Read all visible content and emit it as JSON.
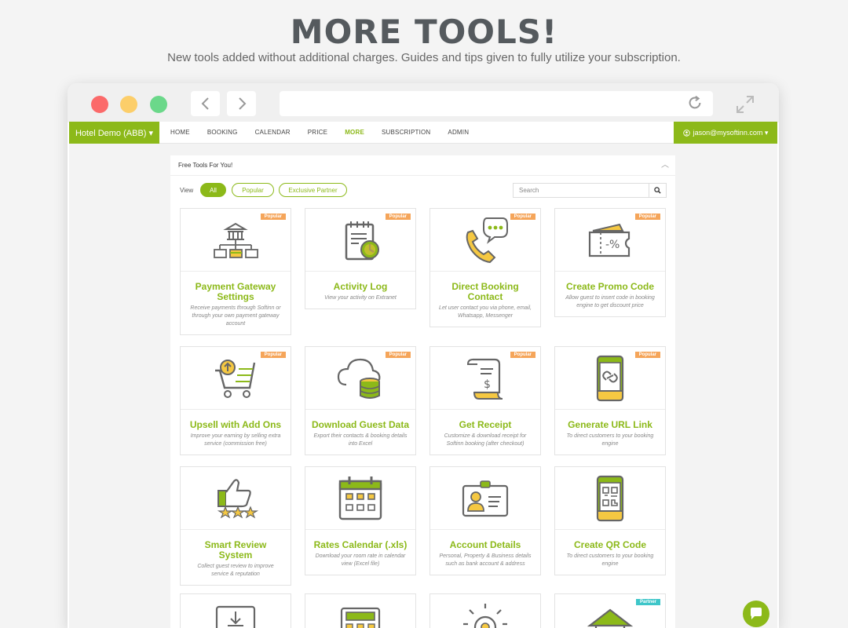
{
  "hero": {
    "title": "MORE TOOLS!",
    "subtitle": "New tools added without additional charges. Guides and tips given to fully utilize your subscription."
  },
  "browser": {
    "back_icon": "chevron-left-icon",
    "forward_icon": "chevron-right-icon",
    "reload_icon": "reload-icon",
    "expand_icon": "expand-icon"
  },
  "nav": {
    "hotel": "Hotel Demo (ABB) ▾",
    "items": [
      "HOME",
      "BOOKING",
      "CALENDAR",
      "PRICE",
      "MORE",
      "SUBSCRIPTION",
      "ADMIN"
    ],
    "active": "MORE",
    "user": "jason@mysoftinn.com ▾"
  },
  "panel": {
    "title": "Free Tools For You!",
    "view_label": "View",
    "filters": [
      "All",
      "Popular",
      "Exclusive Partner"
    ],
    "active_filter": "All",
    "search_placeholder": "Search"
  },
  "tools": [
    {
      "title": "Payment Gateway Settings",
      "desc": "Receive payments through Softinn or through your own payment gateway account",
      "badge": "Popular",
      "icon": "bank-transfer-icon"
    },
    {
      "title": "Activity Log",
      "desc": "View your activity on Extranet",
      "badge": "Popular",
      "icon": "activity-log-icon"
    },
    {
      "title": "Direct Booking Contact",
      "desc": "Let user contact you via phone, email, Whatsapp, Messenger",
      "badge": "Popular",
      "icon": "phone-chat-icon"
    },
    {
      "title": "Create Promo Code",
      "desc": "Allow guest to insert code in booking engine to get discount price",
      "badge": "Popular",
      "icon": "promo-ticket-icon"
    },
    {
      "title": "Upsell with Add Ons",
      "desc": "Improve your earning by selling extra service (commission free)",
      "badge": "Popular",
      "icon": "cart-upsell-icon"
    },
    {
      "title": "Download Guest Data",
      "desc": "Export their contacts & booking details into Excel",
      "badge": "Popular",
      "icon": "cloud-database-icon"
    },
    {
      "title": "Get Receipt",
      "desc": "Customize & download receipt for Softinn booking (after checkout)",
      "badge": "Popular",
      "icon": "receipt-icon"
    },
    {
      "title": "Generate URL Link",
      "desc": "To direct customers to your booking engine",
      "badge": "Popular",
      "icon": "mobile-link-icon"
    },
    {
      "title": "Smart Review System",
      "desc": "Collect guest review to improve service & reputation",
      "badge": "",
      "icon": "thumbs-up-stars-icon"
    },
    {
      "title": "Rates Calendar (.xls)",
      "desc": "Download your room rate in calendar view (Excel file)",
      "badge": "",
      "icon": "calendar-icon"
    },
    {
      "title": "Account Details",
      "desc": "Personal, Property & Business details such as bank account & address",
      "badge": "",
      "icon": "id-card-icon"
    },
    {
      "title": "Create QR Code",
      "desc": "To direct customers to your booking engine",
      "badge": "",
      "icon": "mobile-qr-icon"
    },
    {
      "title": "",
      "desc": "",
      "badge": "",
      "icon": "facebook-download-icon"
    },
    {
      "title": "",
      "desc": "",
      "badge": "",
      "icon": "calculator-icon"
    },
    {
      "title": "",
      "desc": "",
      "badge": "",
      "icon": "lightbulb-icon"
    },
    {
      "title": "",
      "desc": "",
      "badge": "Partner",
      "icon": "house-chart-icon"
    }
  ],
  "colors": {
    "accent": "#8cb919",
    "popular": "#f5a55a",
    "partner": "#3ec6c9",
    "text_dark": "#555a5e"
  },
  "chat_icon": "chat-bubble-icon"
}
